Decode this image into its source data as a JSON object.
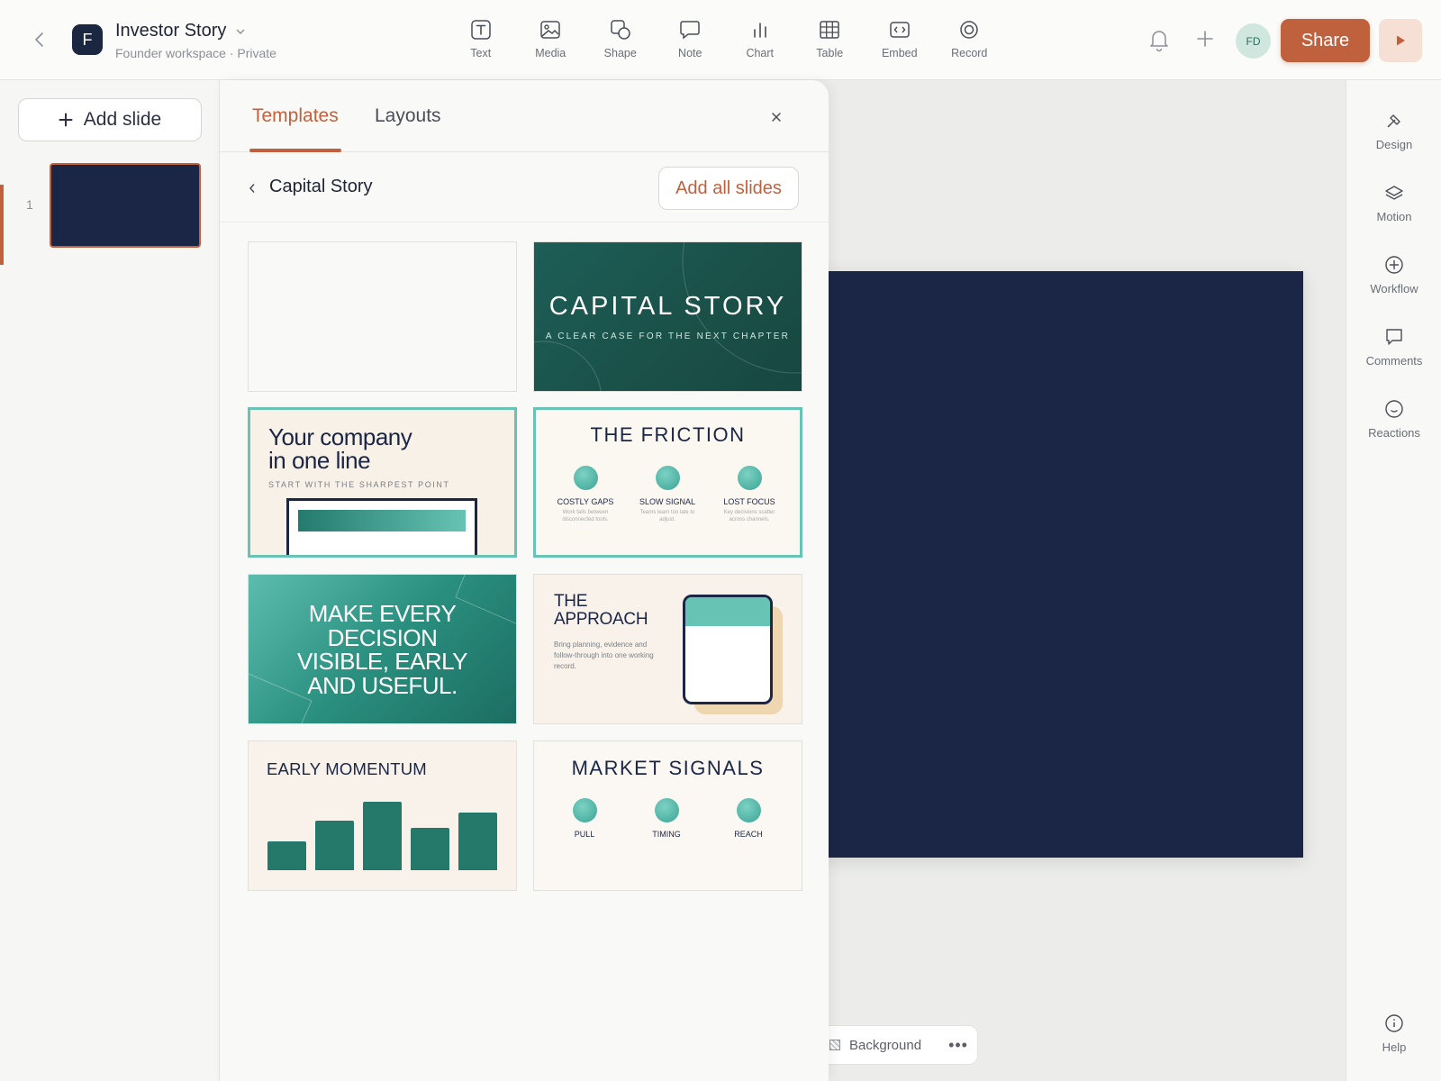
{
  "header": {
    "doc_title": "Investor Story",
    "workspace_logo": "F",
    "doc_subtitle": "Founder workspace · Private",
    "tools": [
      {
        "label": "Text",
        "icon": "text-icon"
      },
      {
        "label": "Media",
        "icon": "image-icon"
      },
      {
        "label": "Shape",
        "icon": "shape-icon"
      },
      {
        "label": "Note",
        "icon": "note-icon"
      },
      {
        "label": "Chart",
        "icon": "chart-icon"
      },
      {
        "label": "Table",
        "icon": "table-icon"
      },
      {
        "label": "Embed",
        "icon": "embed-icon"
      },
      {
        "label": "Record",
        "icon": "record-icon"
      }
    ],
    "avatar_initials": "FD",
    "share_label": "Share",
    "accent_color": "#c0613e"
  },
  "slides_panel": {
    "add_slide_label": "Add slide",
    "slides": [
      {
        "number": "1",
        "background": "#1b2646"
      }
    ]
  },
  "templates_panel": {
    "tabs": [
      {
        "label": "Templates",
        "active": true
      },
      {
        "label": "Layouts",
        "active": false
      }
    ],
    "breadcrumb_title": "Capital Story",
    "add_all_label": "Add all slides",
    "cards": {
      "capital": {
        "title": "CAPITAL STORY",
        "subtitle": "A CLEAR CASE FOR THE NEXT CHAPTER"
      },
      "company": {
        "title_line1": "Your company",
        "title_line2": "in one line",
        "subtitle": "START WITH THE SHARPEST POINT"
      },
      "friction": {
        "title": "THE FRICTION",
        "items": [
          {
            "label": "COSTLY GAPS",
            "desc": "Work falls between disconnected tools."
          },
          {
            "label": "SLOW SIGNAL",
            "desc": "Teams learn too late to adjust."
          },
          {
            "label": "LOST FOCUS",
            "desc": "Key decisions scatter across channels."
          }
        ]
      },
      "decision": {
        "line1": "MAKE EVERY",
        "line2": "DECISION",
        "line3": "VISIBLE, EARLY",
        "line4": "AND USEFUL."
      },
      "approach": {
        "title_line1": "THE",
        "title_line2": "APPROACH",
        "body": "Bring planning, evidence and follow-through into one working record."
      },
      "momentum": {
        "title": "EARLY MOMENTUM",
        "bars": [
          0.42,
          0.72,
          1.0,
          0.62,
          0.84
        ]
      },
      "market": {
        "title": "MARKET SIGNALS",
        "items": [
          {
            "label": "PULL"
          },
          {
            "label": "TIMING"
          },
          {
            "label": "REACH"
          }
        ]
      }
    }
  },
  "canvas": {
    "slide_background": "#1b2646",
    "background_label": "Background"
  },
  "right_rail": {
    "items": [
      {
        "label": "Design",
        "icon": "design-icon"
      },
      {
        "label": "Motion",
        "icon": "layers-icon"
      },
      {
        "label": "Workflow",
        "icon": "workflow-icon"
      },
      {
        "label": "Comments",
        "icon": "comment-icon"
      },
      {
        "label": "Reactions",
        "icon": "smiley-icon"
      }
    ],
    "help_label": "Help"
  }
}
